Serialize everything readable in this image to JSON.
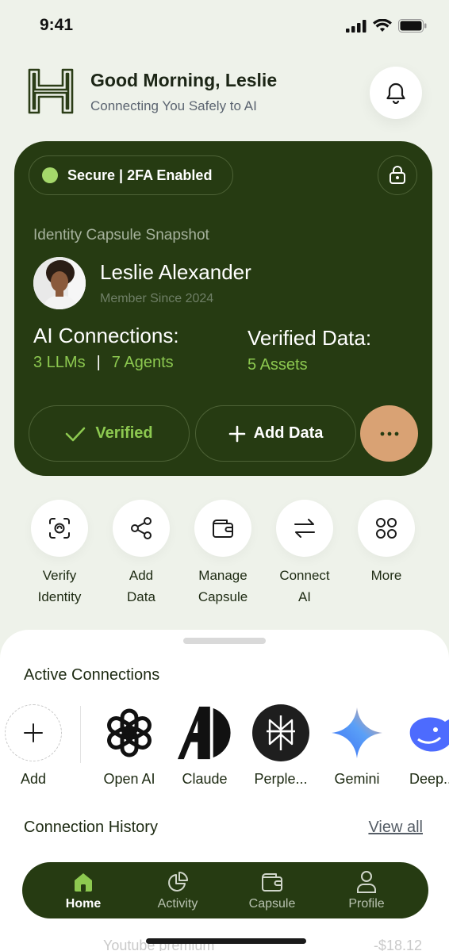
{
  "status": {
    "time": "9:41"
  },
  "header": {
    "greeting": "Good Morning, Leslie",
    "tagline": "Connecting You Safely to AI"
  },
  "card": {
    "secure_text": "Secure | 2FA Enabled",
    "snapshot_label": "Identity Capsule Snapshot",
    "user_name": "Leslie Alexander",
    "member_since": "Member Since 2024",
    "ai_connections_label": "AI Connections:",
    "llms": "3 LLMs",
    "separator": "|",
    "agents": "7 Agents",
    "verified_data_label": "Verified Data:",
    "assets": "5 Assets",
    "verified_button": "Verified",
    "add_data_button": "Add Data"
  },
  "actions": [
    {
      "label1": "Verify",
      "label2": "Identity"
    },
    {
      "label1": "Add",
      "label2": "Data"
    },
    {
      "label1": "Manage",
      "label2": "Capsule"
    },
    {
      "label1": "Connect",
      "label2": "AI"
    },
    {
      "label1": "More",
      "label2": ""
    }
  ],
  "active_connections": {
    "title": "Active Connections",
    "items": [
      "Add",
      "Open AI",
      "Claude",
      "Perple...",
      "Gemini",
      "Deep..."
    ]
  },
  "history": {
    "title": "Connection History",
    "view_all": "View all",
    "partial_row_name": "Youtube premium",
    "partial_row_amount": "-$18.12"
  },
  "tabs": [
    "Home",
    "Activity",
    "Capsule",
    "Profile"
  ],
  "colors": {
    "card_bg": "#263b12",
    "accent_green": "#8dc950",
    "more_button": "#d9a274",
    "page_bg": "#eef2ea"
  }
}
